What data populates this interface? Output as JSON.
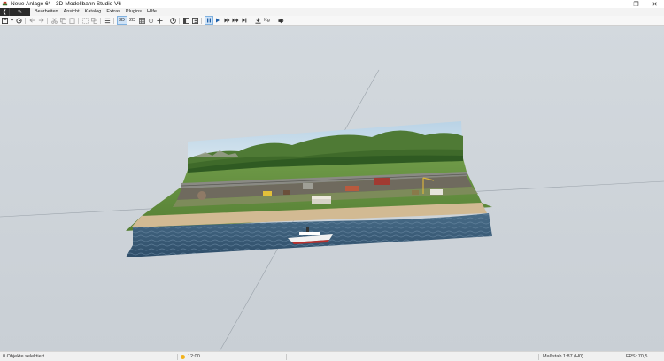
{
  "window": {
    "title": "Neue Anlage 6* - 3D-Modellbahn Studio V6",
    "minimize_glyph": "—",
    "maximize_glyph": "❐",
    "close_glyph": "✕"
  },
  "menu": {
    "back_glyph": "❮",
    "edit_glyph": "✎",
    "items": [
      "Bearbeiten",
      "Ansicht",
      "Katalog",
      "Extras",
      "Plugins",
      "Hilfe"
    ]
  },
  "toolbar": {
    "view_3d": "3D",
    "view_2d": "2D",
    "label_kg": "Kg"
  },
  "status": {
    "selection": "0 Objekte selektiert",
    "time": "12:00",
    "scale": "Maßstab 1:87 (H0)",
    "fps": "FPS: 70,5"
  },
  "colors": {
    "viewport": "#cdd3d9",
    "grass": "#5f8e3c",
    "water": "#3b5c78",
    "sand": "#cdb68f",
    "sky": "#c7dbe8"
  },
  "icons": [
    "app-icon",
    "save-icon",
    "dropdown-icon",
    "undo-icon",
    "redo-icon",
    "cut-icon",
    "copy-icon",
    "paste-icon",
    "group-icon",
    "ungroup-icon",
    "layers-icon",
    "grid-icon",
    "snap-icon",
    "move-icon",
    "clock-icon",
    "panel-left-icon",
    "panel-right-icon",
    "pause-icon",
    "play-icon",
    "fast-forward-icon",
    "skip-forward-icon",
    "skip-end-icon",
    "export-icon",
    "speaker-icon"
  ]
}
